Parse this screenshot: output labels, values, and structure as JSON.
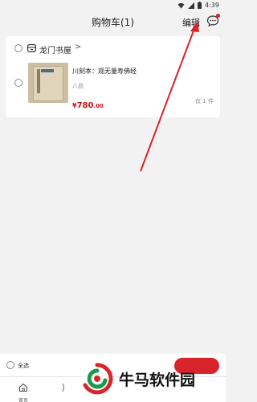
{
  "status": {
    "time": "4:39"
  },
  "header": {
    "title": "购物车(1)",
    "edit_label": "编辑"
  },
  "cart": {
    "shop": {
      "name": "龙门书屋",
      "chevron": ">"
    },
    "item": {
      "title": "川刻本：观无量寿佛经",
      "tag": "八品",
      "price_symbol": "¥",
      "price_int": "780",
      "price_dec": ".00",
      "quantity": "仅 1 件"
    }
  },
  "footer": {
    "select_all": "全选"
  },
  "tabs": [
    {
      "label": "首页"
    }
  ],
  "watermark": {
    "text": "牛马软件园"
  },
  "colors": {
    "accent": "#d8232a",
    "price": "#c8121b",
    "background": "#f2f2f2"
  }
}
